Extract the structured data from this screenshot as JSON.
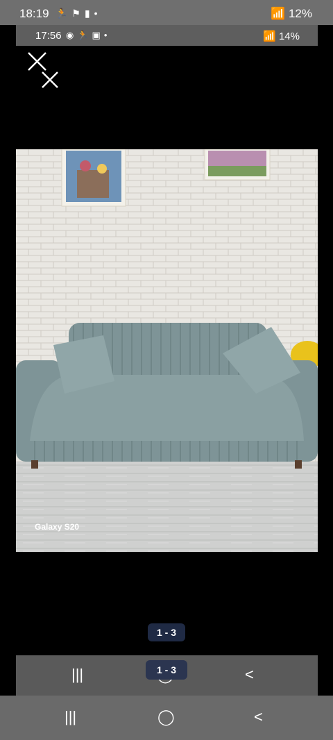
{
  "outer_status": {
    "time": "18:19",
    "battery": "12%"
  },
  "inner_status": {
    "time": "17:56",
    "battery": "14%"
  },
  "photo": {
    "watermark": "Galaxy S20"
  },
  "counter": {
    "label": "1 - 3",
    "label2": "1 - 3"
  },
  "nav": {
    "recent": "|||",
    "home": "◯",
    "back": "<"
  }
}
